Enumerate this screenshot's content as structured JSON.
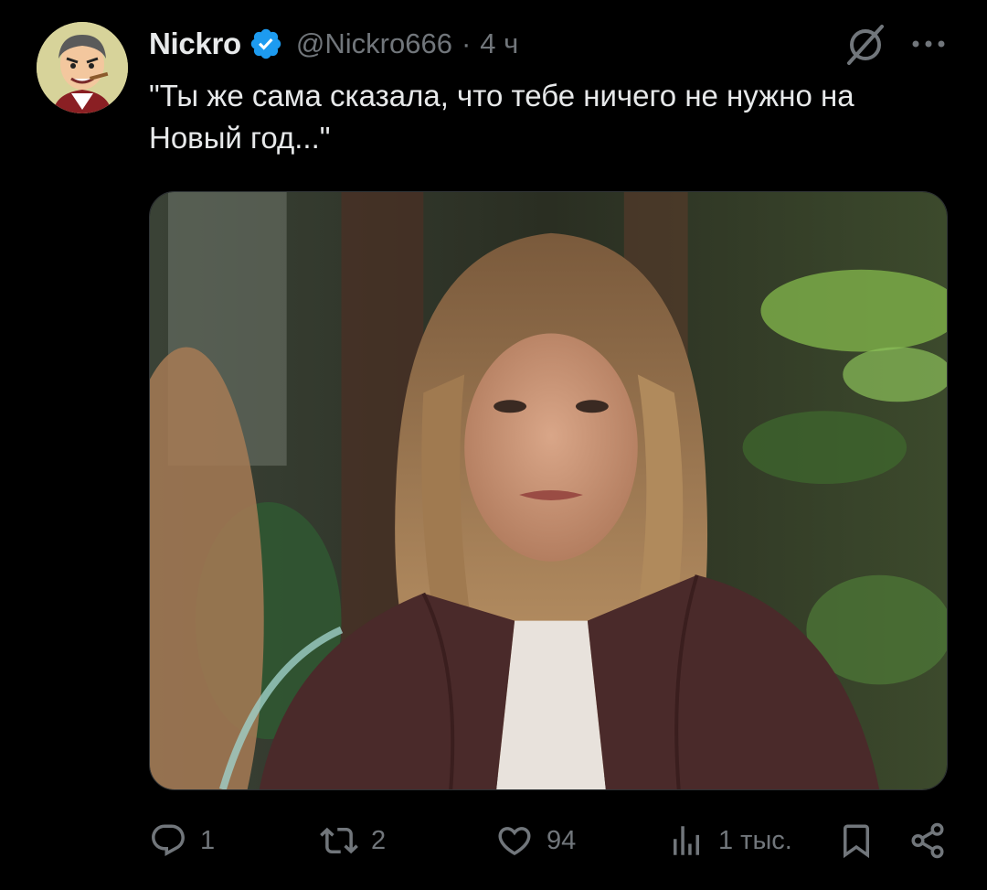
{
  "tweet": {
    "author": {
      "display_name": "Nickro",
      "handle": "@Nickro666",
      "verified": true
    },
    "separator": "·",
    "time": "4 ч",
    "text": "\"Ты же сама сказала, что тебе ничего не нужно на Новый год...\""
  },
  "actions": {
    "replies": "1",
    "reposts": "2",
    "likes": "94",
    "views": "1 тыс."
  },
  "colors": {
    "background": "#000000",
    "text": "#e7e9ea",
    "muted": "#71767b",
    "verified": "#1d9bf0"
  },
  "icons": [
    "verified-badge-icon",
    "grok-icon",
    "more-icon",
    "reply-icon",
    "retweet-icon",
    "like-icon",
    "views-icon",
    "bookmark-icon",
    "share-icon"
  ]
}
